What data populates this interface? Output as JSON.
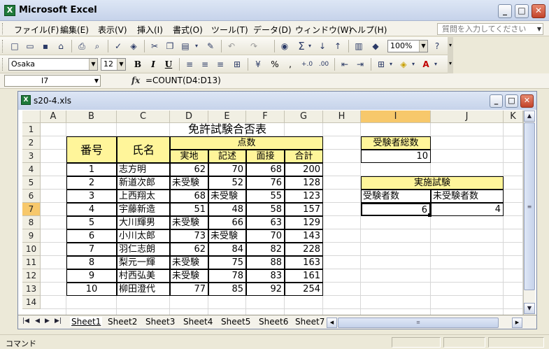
{
  "app": {
    "title": "Microsoft Excel"
  },
  "window_buttons": {
    "minimize": "_",
    "maximize": "□",
    "close": "✕"
  },
  "menu": {
    "items": [
      "ファイル(F)",
      "編集(E)",
      "表示(V)",
      "挿入(I)",
      "書式(O)",
      "ツール(T)",
      "データ(D)",
      "ウィンドウ(W)",
      "ヘルプ(H)"
    ],
    "help_placeholder": "質問を入力してください"
  },
  "standard_toolbar": {
    "zoom": "100%"
  },
  "format_toolbar": {
    "font": "Osaka",
    "size": "12",
    "bold": "B",
    "italic": "I",
    "underline": "U",
    "percent": "%",
    "comma": ","
  },
  "formula_bar": {
    "cell_ref": "I7",
    "fx": "fx",
    "formula": "=COUNT(D4:D13)"
  },
  "workbook": {
    "title": "s20-4.xls"
  },
  "columns": [
    "A",
    "B",
    "C",
    "D",
    "E",
    "F",
    "G",
    "H",
    "I",
    "J",
    "K"
  ],
  "active_cell": {
    "row": "7",
    "col": "I"
  },
  "rows": [
    "1",
    "2",
    "3",
    "4",
    "5",
    "6",
    "7",
    "8",
    "9",
    "10",
    "11",
    "12",
    "13",
    "14"
  ],
  "sheet": {
    "title": "免許試験合否表",
    "headers": {
      "number": "番号",
      "name": "氏名",
      "score": "点数",
      "practical": "実地",
      "written": "記述",
      "interview": "面接",
      "total": "合計"
    },
    "records": [
      {
        "no": "1",
        "name": "志方明",
        "practical": "62",
        "written": "70",
        "interview": "68",
        "total": "200"
      },
      {
        "no": "2",
        "name": "新道次郎",
        "practical": "未受験",
        "written": "52",
        "interview": "76",
        "total": "128"
      },
      {
        "no": "3",
        "name": "上西翔太",
        "practical": "68",
        "written": "未受験",
        "interview": "55",
        "total": "123"
      },
      {
        "no": "4",
        "name": "宇藤新造",
        "practical": "51",
        "written": "48",
        "interview": "58",
        "total": "157"
      },
      {
        "no": "5",
        "name": "大川輝男",
        "practical": "未受験",
        "written": "66",
        "interview": "63",
        "total": "129"
      },
      {
        "no": "6",
        "name": "小川太郎",
        "practical": "73",
        "written": "未受験",
        "interview": "70",
        "total": "143"
      },
      {
        "no": "7",
        "name": "羽仁志朗",
        "practical": "62",
        "written": "84",
        "interview": "82",
        "total": "228"
      },
      {
        "no": "8",
        "name": "梨元一輝",
        "practical": "未受験",
        "written": "75",
        "interview": "88",
        "total": "163"
      },
      {
        "no": "9",
        "name": "村西弘美",
        "practical": "未受験",
        "written": "78",
        "interview": "83",
        "total": "161"
      },
      {
        "no": "10",
        "name": "柳田澄代",
        "practical": "77",
        "written": "85",
        "interview": "92",
        "total": "254"
      }
    ],
    "summary": {
      "total_label": "受験者総数",
      "total_value": "10",
      "exam_label": "実施試験",
      "taken_label": "受験者数",
      "not_taken_label": "未受験者数",
      "taken_value": "6",
      "not_taken_value": "4"
    }
  },
  "tabs": [
    "Sheet1",
    "Sheet2",
    "Sheet3",
    "Sheet4",
    "Sheet5",
    "Sheet6",
    "Sheet7"
  ],
  "status": {
    "text": "コマンド"
  }
}
